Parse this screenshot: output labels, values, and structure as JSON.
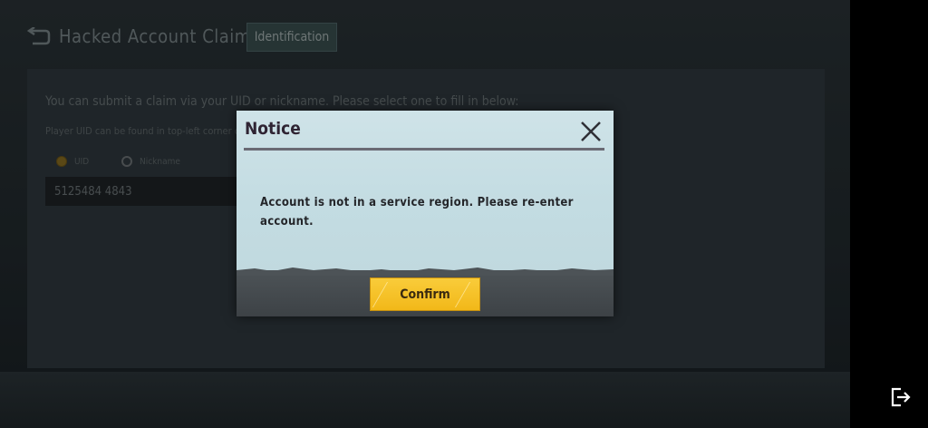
{
  "header": {
    "title": "Hacked Account Claims",
    "tab_label": "Identification"
  },
  "form": {
    "instruction": "You can submit a claim via your UID or nickname. Please select one to fill in below:",
    "hint": "Player UID can be found in top-left corner of",
    "radio_uid_label": "UID",
    "radio_nickname_label": "Nickname",
    "uid_value": "5125484 4843"
  },
  "dialog": {
    "title": "Notice",
    "message": "Account is not in a service region. Please re-enter account.",
    "confirm_label": "Confirm"
  },
  "colors": {
    "confirm_button": "#f6c027",
    "dialog_background": "#c9e0e5"
  }
}
